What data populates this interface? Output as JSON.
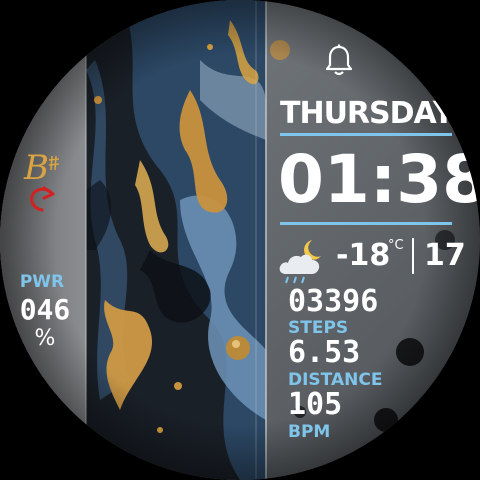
{
  "watch": {
    "day": "THURSDAY",
    "time": "01:38",
    "temperature": "-18",
    "temp_unit": "°C",
    "date": "17",
    "steps_value": "03396",
    "steps_label": "STEPS",
    "distance_value": "6.53",
    "distance_label": "DISTANCE",
    "heart_value": "105",
    "heart_label": "BPM",
    "power_label": "PWR",
    "power_value": "046",
    "power_unit": "%",
    "logo_text": "B"
  },
  "colors": {
    "accent_blue": "#7fc4ea",
    "text_white": "#ffffff",
    "logo_gold": "#d9a441",
    "arrow_red": "#d32020"
  },
  "icons": {
    "alarm": "bell-icon",
    "weather": "moon-cloud-rain-icon",
    "logo": "b-sharp-logo-icon"
  }
}
